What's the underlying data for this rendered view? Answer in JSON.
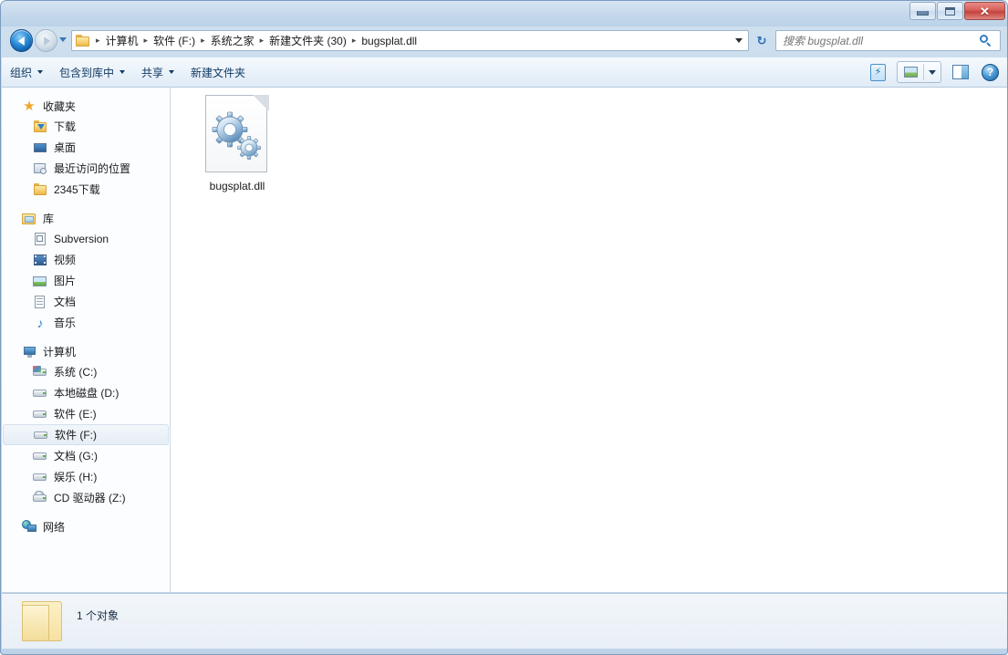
{
  "window": {
    "controls": {
      "minimize": "minimize-button",
      "maximize": "maximize-button",
      "close": "✕"
    }
  },
  "address": {
    "crumbs": [
      "计算机",
      "软件 (F:)",
      "系统之家",
      "新建文件夹 (30)",
      "bugsplat.dll"
    ],
    "separator": "▸",
    "refresh_glyph": "↻"
  },
  "search": {
    "placeholder": "搜索 bugsplat.dll",
    "value": ""
  },
  "toolbar": {
    "items": [
      {
        "label": "组织",
        "has_caret": true
      },
      {
        "label": "包含到库中",
        "has_caret": true
      },
      {
        "label": "共享",
        "has_caret": true
      },
      {
        "label": "新建文件夹",
        "has_caret": false
      }
    ],
    "help_glyph": "?"
  },
  "sidebar": {
    "groups": [
      {
        "root": {
          "label": "收藏夹",
          "icon": "star-icon"
        },
        "children": [
          {
            "label": "下载",
            "icon": "download-folder-icon"
          },
          {
            "label": "桌面",
            "icon": "desktop-icon"
          },
          {
            "label": "最近访问的位置",
            "icon": "recent-places-icon"
          },
          {
            "label": "2345下载",
            "icon": "folder-icon"
          }
        ]
      },
      {
        "root": {
          "label": "库",
          "icon": "library-icon"
        },
        "children": [
          {
            "label": "Subversion",
            "icon": "subversion-icon"
          },
          {
            "label": "视频",
            "icon": "video-icon"
          },
          {
            "label": "图片",
            "icon": "pictures-icon"
          },
          {
            "label": "文档",
            "icon": "documents-icon"
          },
          {
            "label": "音乐",
            "icon": "music-icon"
          }
        ]
      },
      {
        "root": {
          "label": "计算机",
          "icon": "computer-icon"
        },
        "children": [
          {
            "label": "系统 (C:)",
            "icon": "system-drive-icon",
            "selected": false
          },
          {
            "label": "本地磁盘 (D:)",
            "icon": "drive-icon",
            "selected": false
          },
          {
            "label": "软件 (E:)",
            "icon": "drive-icon",
            "selected": false
          },
          {
            "label": "软件 (F:)",
            "icon": "drive-icon",
            "selected": true
          },
          {
            "label": "文档 (G:)",
            "icon": "drive-icon",
            "selected": false
          },
          {
            "label": "娱乐 (H:)",
            "icon": "drive-icon",
            "selected": false
          },
          {
            "label": "CD 驱动器 (Z:)",
            "icon": "cd-drive-icon",
            "selected": false
          }
        ]
      },
      {
        "root": {
          "label": "网络",
          "icon": "network-icon"
        },
        "children": []
      }
    ]
  },
  "content": {
    "files": [
      {
        "name": "bugsplat.dll",
        "icon": "dll-gears-icon"
      }
    ]
  },
  "status": {
    "text": "1 个对象",
    "icon": "folder-icon"
  }
}
